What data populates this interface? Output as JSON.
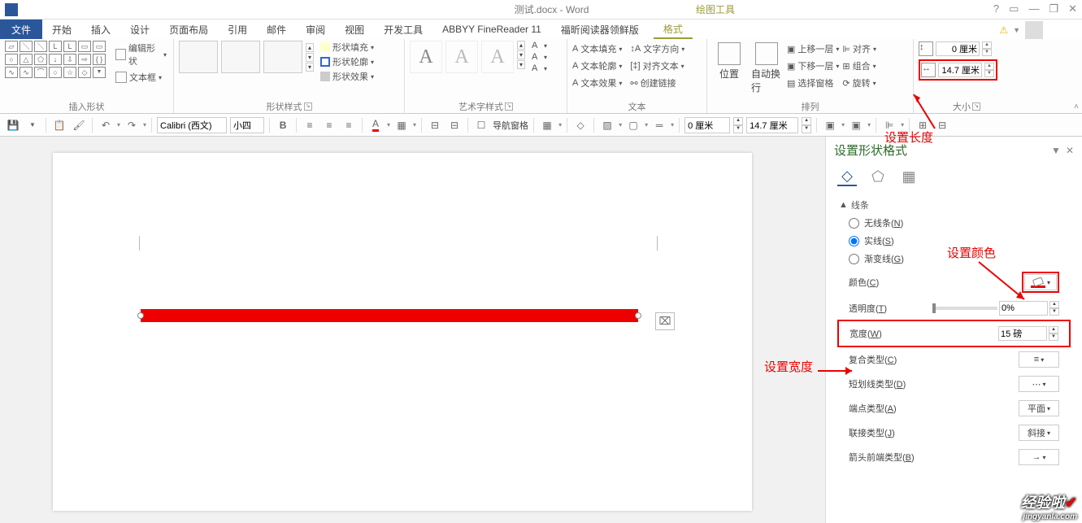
{
  "titlebar": {
    "title": "测试.docx - Word",
    "tool_tab": "绘图工具"
  },
  "tabs": {
    "file": "文件",
    "home": "开始",
    "insert": "插入",
    "design": "设计",
    "layout": "页面布局",
    "references": "引用",
    "mailings": "邮件",
    "review": "审阅",
    "view": "视图",
    "developer": "开发工具",
    "abbyy": "ABBYY FineReader 11",
    "foxit": "福昕阅读器领鲜版",
    "format": "格式"
  },
  "ribbon": {
    "insert_shapes": {
      "edit_shape": "编辑形状",
      "text_box": "文本框",
      "label": "插入形状"
    },
    "shape_styles": {
      "fill": "形状填充",
      "outline": "形状轮廓",
      "effects": "形状效果",
      "label": "形状样式"
    },
    "wordart": {
      "label": "艺术字样式",
      "sample": "A",
      "text_fill": "文本填充",
      "text_outline": "文本轮廓",
      "text_effects": "文本效果"
    },
    "text": {
      "direction": "文字方向",
      "align": "对齐文本",
      "link": "创建链接",
      "label": "文本"
    },
    "arrange": {
      "position": "位置",
      "wrap": "自动换行",
      "forward": "上移一层",
      "backward": "下移一层",
      "selection": "选择窗格",
      "align": "对齐",
      "group": "组合",
      "rotate": "旋转",
      "label": "排列"
    },
    "size": {
      "height": "0 厘米",
      "width": "14.7 厘米",
      "label": "大小"
    }
  },
  "qat": {
    "font": "Calibri (西文)",
    "size": "小四",
    "nav": "导航窗格",
    "h": "0 厘米",
    "w": "14.7 厘米"
  },
  "sidepane": {
    "title": "设置形状格式",
    "line_section": "线条",
    "no_line": "无线条(N)",
    "solid": "实线(S)",
    "gradient": "渐变线(G)",
    "color": "颜色(C)",
    "transparency": "透明度(T)",
    "transparency_val": "0%",
    "width": "宽度(W)",
    "width_val": "15 磅",
    "compound": "复合类型(C)",
    "dash": "短划线类型(D)",
    "cap": "端点类型(A)",
    "cap_val": "平面",
    "join": "联接类型(J)",
    "join_val": "斜接",
    "arrow_begin": "箭头前端类型(B)"
  },
  "annotations": {
    "set_length": "设置长度",
    "set_color": "设置颜色",
    "set_width": "设置宽度"
  },
  "watermark": {
    "main": "经验啦",
    "sub": "jingyanla.com"
  }
}
